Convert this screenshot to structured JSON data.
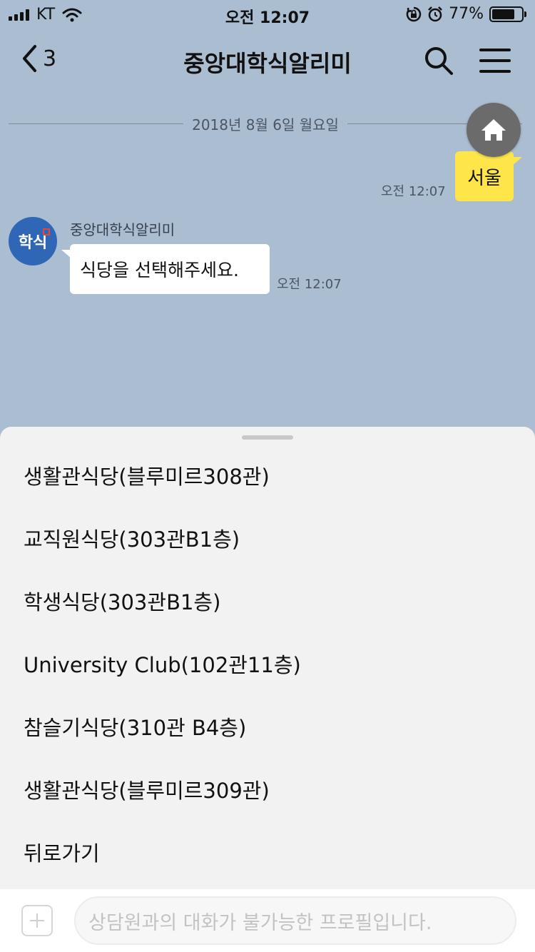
{
  "status_bar": {
    "carrier": "KT",
    "time": "오전 12:07",
    "battery_percent_label": "77%",
    "battery_level": 0.77
  },
  "nav": {
    "back_count": "3",
    "title": "중앙대학식알리미"
  },
  "chat": {
    "date_divider": "2018년 8월 6일 월요일",
    "my_message": {
      "text": "서울",
      "time": "오전 12:07"
    },
    "bot": {
      "avatar_text": "학식",
      "name": "중앙대학식알리미",
      "message": "식당을 선택해주세요.",
      "time": "오전 12:07"
    }
  },
  "quick_replies": [
    "생활관식당(블루미르308관)",
    "교직원식당(303관B1층)",
    "학생식당(303관B1층)",
    "University Club(102관11층)",
    "참슬기식당(310관 B4층)",
    "생활관식당(블루미르309관)",
    "뒤로가기"
  ],
  "input": {
    "placeholder": "상담원과의 대화가 불가능한 프로필입니다."
  },
  "colors": {
    "chat_background": "#abbdd1",
    "my_bubble": "#fde54a",
    "avatar": "#2f66b6",
    "sheet": "#f2f2f2"
  },
  "icons": [
    "signal-icon",
    "wifi-icon",
    "rotation-lock-icon",
    "alarm-icon",
    "battery-icon",
    "back-chevron-icon",
    "search-icon",
    "menu-icon",
    "home-icon",
    "plus-icon"
  ]
}
